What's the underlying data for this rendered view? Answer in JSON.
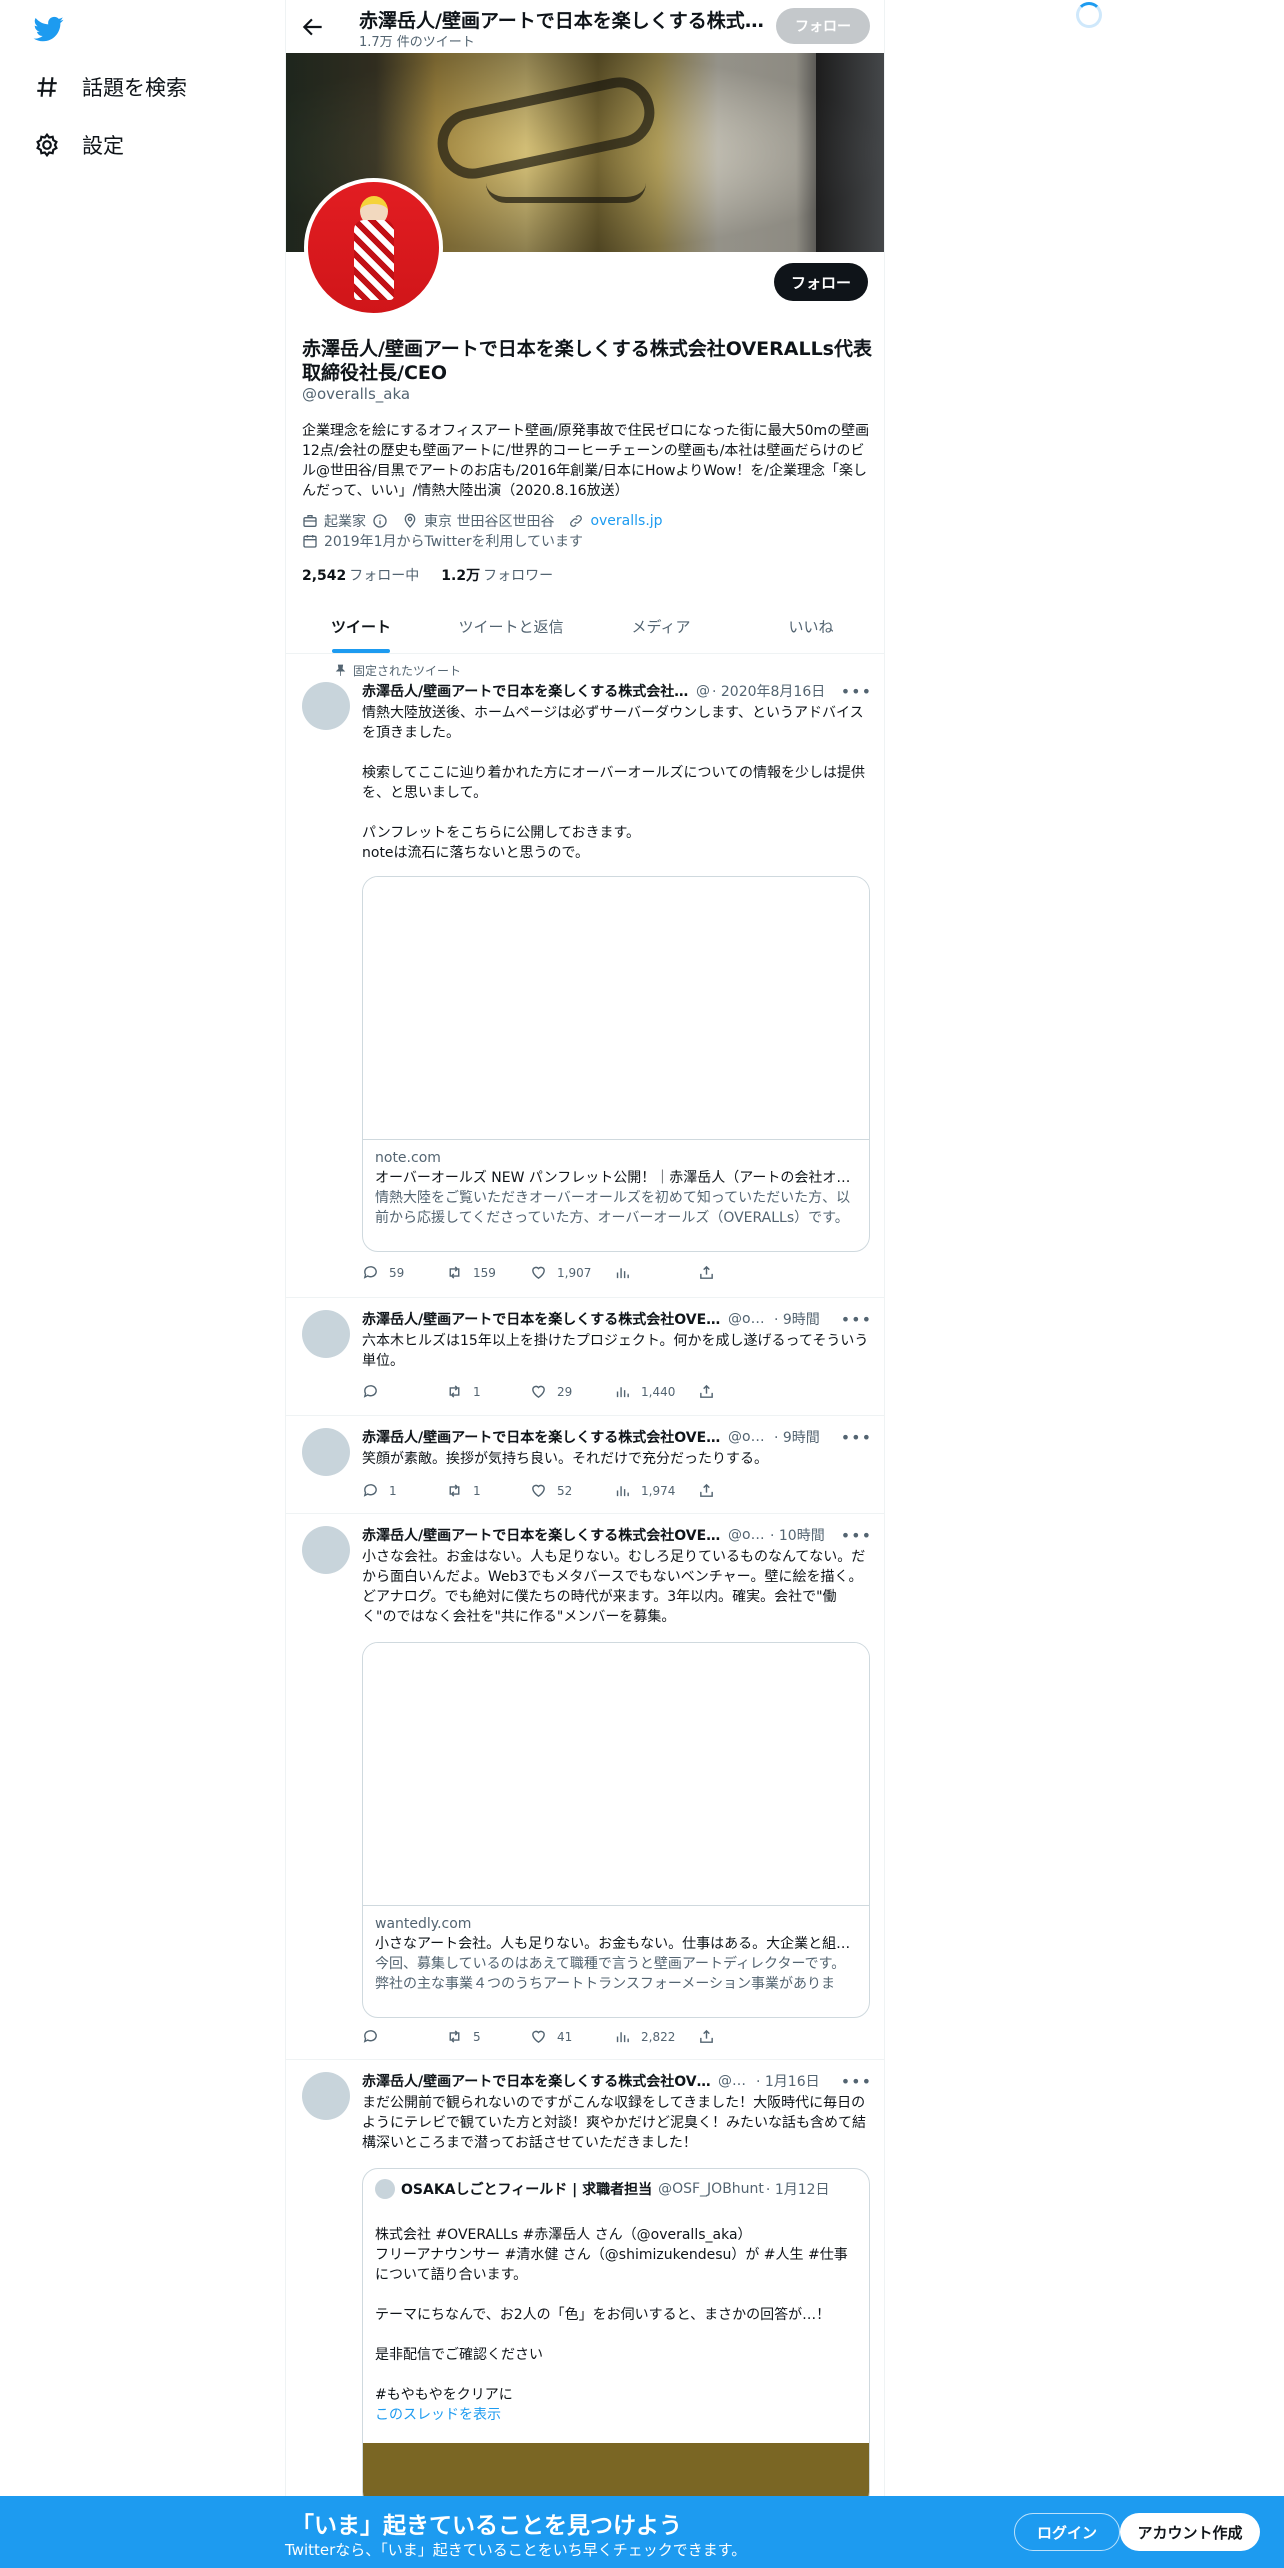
{
  "sidebar": {
    "explore_label": "話題を検索",
    "settings_label": "設定"
  },
  "header": {
    "title": "赤澤岳人/壁画アートで日本を楽しくする株式会社OVERALLs代表取締役社長/CEO",
    "tweet_count": "1.7万 件のツイート",
    "follow_label": "フォロー"
  },
  "profile": {
    "follow_label": "フォロー",
    "name": "赤澤岳人/壁画アートで日本を楽しくする株式会社OVERALLs代表取締役社長/CEO",
    "handle": "@overalls_aka",
    "bio": "企業理念を絵にするオフィスアート壁画/原発事故で住民ゼロになった街に最大50mの壁画12点/会社の歴史も壁画アートに/世界的コーヒーチェーンの壁画も/本社は壁画だらけのビル@世田谷/目黒でアートのお店も/2016年創業/日本にHowよりWow！を/企業理念「楽しんだって、いい」/情熱大陸出演（2020.8.16放送）",
    "category": "起業家",
    "location": "東京 世田谷区世田谷",
    "website": "overalls.jp",
    "joined": "2019年1月からTwitterを利用しています",
    "following_count": "2,542",
    "following_label": "フォロー中",
    "followers_count": "1.2万",
    "followers_label": "フォロワー"
  },
  "tabs": [
    "ツイート",
    "ツイートと返信",
    "メディア",
    "いいね"
  ],
  "tweets": [
    {
      "pinned_label": "固定されたツイート",
      "name": "赤澤岳人/壁画アートで日本を楽しくする株式会社OVERALLs代表取締役社長/CEO",
      "handle": "@",
      "time": "· 2020年8月16日",
      "body": "情熱大陸放送後、ホームページは必ずサーバーダウンします、というアドバイスを頂きました。\n\n検索してここに辿り着かれた方にオーバーオールズについての情報を少しは提供を、と思いまして。\n\nパンフレットをこちらに公開しておきます。\nnoteは流石に落ちないと思うので。",
      "card": {
        "domain": "note.com",
        "title": "オーバーオールズ NEW パンフレット公開！｜赤澤岳人（アートの会社オーバーオールズ）｜note",
        "description": "情熱大陸をご覧いただきオーバーオールズを初めて知っていただいた方、以前から応援してくださっていた方、オーバーオールズ（OVERALLs）です。"
      },
      "replies": "59",
      "retweets": "159",
      "likes": "1,907",
      "views": ""
    },
    {
      "name": "赤澤岳人/壁画アートで日本を楽しくする株式会社OVERALLs代表取締役社長/CEO",
      "handle": "@overalls_aka",
      "time": "· 9時間",
      "body": "六本木ヒルズは15年以上を掛けたプロジェクト。何かを成し遂げるってそういう単位。",
      "replies": "",
      "retweets": "1",
      "likes": "29",
      "views": "1,440"
    },
    {
      "name": "赤澤岳人/壁画アートで日本を楽しくする株式会社OVERALLs代表取締役社長/CEO",
      "handle": "@overalls_aka",
      "time": "· 9時間",
      "body": "笑顔が素敵。挨拶が気持ち良い。それだけで充分だったりする。",
      "replies": "1",
      "retweets": "1",
      "likes": "52",
      "views": "1,974"
    },
    {
      "name": "赤澤岳人/壁画アートで日本を楽しくする株式会社OVERALLs代表取締役社長/CEO",
      "handle": "@overalls_aka",
      "time": "· 10時間",
      "body": "小さな会社。お金はない。人も足りない。むしろ足りているものなんてない。だから面白いんだよ。Web3でもメタバースでもないベンチャー。壁に絵を描く。どアナログ。でも絶対に僕たちの時代が来ます。3年以内。確実。会社で\"働く\"のではなく会社を\"共に作る\"メンバーを募集。",
      "card": {
        "domain": "wantedly.com",
        "title": "小さなアート会社。人も足りない。お金もない。仕事はある。大企業と組み、日本をWOWする壁画アートディレクター募集！",
        "description": "今回、募集しているのはあえて職種で言うと壁画アートディレクターです。弊社の主な事業４つのうちアートトランスフォーメーション事業があります。"
      },
      "replies": "",
      "retweets": "5",
      "likes": "41",
      "views": "2,822"
    },
    {
      "name": "赤澤岳人/壁画アートで日本を楽しくする株式会社OVERALLs代表取締役社長/CEO",
      "handle": "@overalls_aka",
      "time": "· 1月16日",
      "body": "まだ公開前で観られないのですがこんな収録をしてきました！大阪時代に毎日のようにテレビで観ていた方と対談！爽やかだけど泥臭く！みたいな話も含めて結構深いところまで潜ってお話させていただきました！",
      "quote": {
        "name": "OSAKAしごとフィールド | 求職者担当",
        "handle": "@OSF_JOBhunt",
        "time": "· 1月12日",
        "body": "株式会社 #OVERALLs #赤澤岳人 さん（@overalls_aka）\nフリーアナウンサー #清水健 さん（@shimizukendesu）が #人生 #仕事 について語り合います。\n\nテーマにちなんで、お2人の「色」をお伺いすると、まさかの回答が…！\n\n是非配信でご確認ください\n\n#もやもやをクリアに",
        "thread_label": "このスレッドを表示"
      }
    }
  ],
  "bottom_bar": {
    "title": "「いま」起きていることを見つけよう",
    "subtitle": "Twitterなら、「いま」起きていることをいち早くチェックできます。",
    "login_label": "ログイン",
    "signup_label": "アカウント作成"
  },
  "colors": {
    "accent": "#1d9bf0",
    "text": "#0f1419",
    "secondary_text": "#536471",
    "disabled_follow": "#c4c8cb"
  }
}
